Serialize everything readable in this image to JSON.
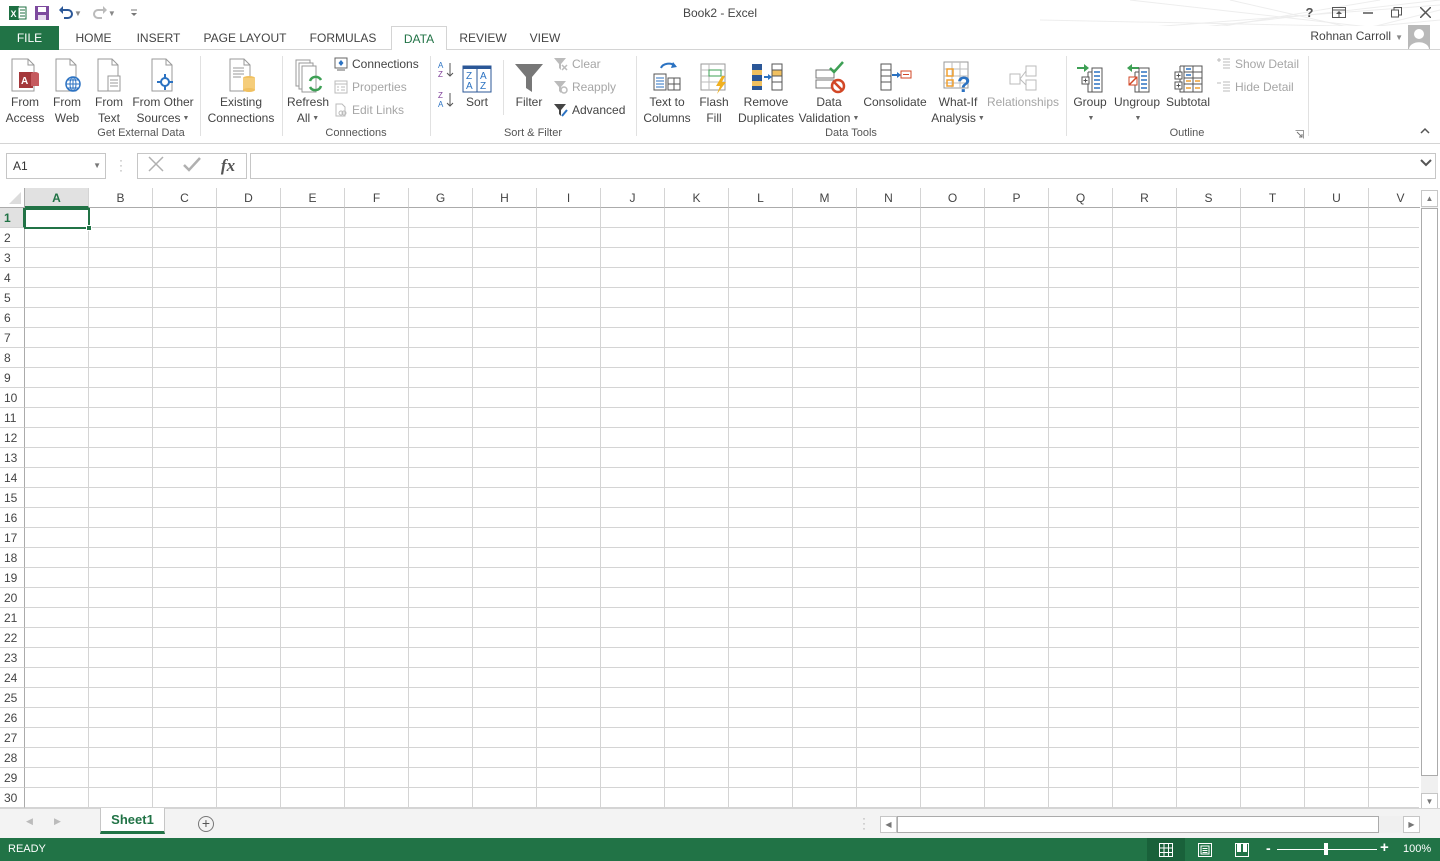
{
  "window": {
    "title": "Book2 - Excel",
    "controls": [
      "help",
      "ribbon-display-options",
      "minimize",
      "restore",
      "close"
    ],
    "help_label": "?"
  },
  "quick_access": {
    "items": [
      "excel-logo",
      "save",
      "undo",
      "redo",
      "customize"
    ]
  },
  "user": {
    "name": "Rohnan Carroll"
  },
  "tabs": [
    {
      "label": "FILE",
      "active": false
    },
    {
      "label": "HOME",
      "active": false
    },
    {
      "label": "INSERT",
      "active": false
    },
    {
      "label": "PAGE LAYOUT",
      "active": false
    },
    {
      "label": "FORMULAS",
      "active": false
    },
    {
      "label": "DATA",
      "active": true
    },
    {
      "label": "REVIEW",
      "active": false
    },
    {
      "label": "VIEW",
      "active": false
    }
  ],
  "ribbon": {
    "groups": {
      "get_external_data": {
        "label": "Get External Data",
        "from_access": {
          "line1": "From",
          "line2": "Access"
        },
        "from_web": {
          "line1": "From",
          "line2": "Web"
        },
        "from_text": {
          "line1": "From",
          "line2": "Text"
        },
        "from_other": {
          "line1": "From Other",
          "line2": "Sources"
        },
        "existing": {
          "line1": "Existing",
          "line2": "Connections"
        }
      },
      "connections": {
        "label": "Connections",
        "refresh": {
          "line1": "Refresh",
          "line2": "All"
        },
        "connections": "Connections",
        "properties": "Properties",
        "edit_links": "Edit Links"
      },
      "sort_filter": {
        "label": "Sort & Filter",
        "sort": "Sort",
        "filter": "Filter",
        "clear": "Clear",
        "reapply": "Reapply",
        "advanced": "Advanced"
      },
      "data_tools": {
        "label": "Data Tools",
        "text_to_columns": {
          "line1": "Text to",
          "line2": "Columns"
        },
        "flash_fill": {
          "line1": "Flash",
          "line2": "Fill"
        },
        "remove_duplicates": {
          "line1": "Remove",
          "line2": "Duplicates"
        },
        "data_validation": {
          "line1": "Data",
          "line2": "Validation"
        },
        "consolidate": "Consolidate",
        "what_if": {
          "line1": "What-If",
          "line2": "Analysis"
        },
        "relationships": "Relationships"
      },
      "outline": {
        "label": "Outline",
        "group": "Group",
        "ungroup": "Ungroup",
        "subtotal": "Subtotal",
        "show_detail": "Show Detail",
        "hide_detail": "Hide Detail"
      }
    }
  },
  "formula_bar": {
    "name_box": "A1",
    "formula": "",
    "fx_label": "fx"
  },
  "sheet": {
    "columns": [
      "A",
      "B",
      "C",
      "D",
      "E",
      "F",
      "G",
      "H",
      "I",
      "J",
      "K",
      "L",
      "M",
      "N",
      "O",
      "P",
      "Q",
      "R",
      "S",
      "T",
      "U",
      "V"
    ],
    "rows": [
      "1",
      "2",
      "3",
      "4",
      "5",
      "6",
      "7",
      "8",
      "9",
      "10",
      "11",
      "12",
      "13",
      "14",
      "15",
      "16",
      "17",
      "18",
      "19",
      "20",
      "21",
      "22",
      "23",
      "24",
      "25",
      "26",
      "27",
      "28",
      "29",
      "30"
    ],
    "active_cell": "A1",
    "tabs": [
      {
        "label": "Sheet1",
        "active": true
      }
    ]
  },
  "status_bar": {
    "status": "READY",
    "zoom": "100%",
    "zoom_percent": 100,
    "view": "normal"
  },
  "colors": {
    "accent": "#217346",
    "status_bg": "#217346"
  }
}
